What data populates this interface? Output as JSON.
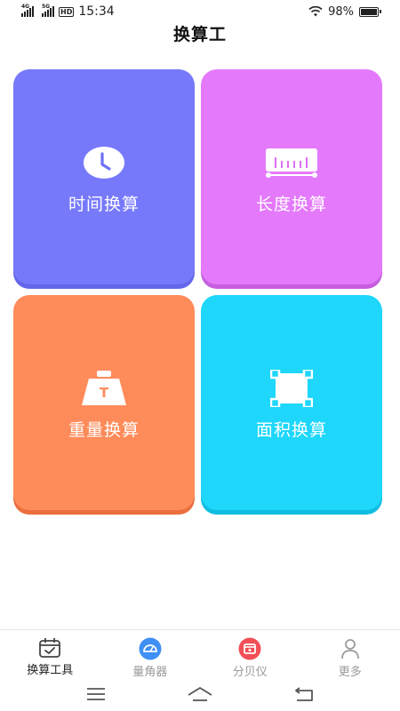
{
  "status_bar": {
    "sim1": "4G",
    "sim2": "5G",
    "hd": "HD",
    "time": "15:34",
    "battery": "98%",
    "battery_level": 0.98
  },
  "header": {
    "title": "换算工"
  },
  "cards": [
    {
      "label": "时间换算",
      "icon": "clock-icon",
      "color": "#7779fb"
    },
    {
      "label": "长度换算",
      "icon": "ruler-icon",
      "color": "#e479fb"
    },
    {
      "label": "重量换算",
      "icon": "weight-icon",
      "color": "#fe8b5a"
    },
    {
      "label": "面积换算",
      "icon": "area-icon",
      "color": "#1ed7fb"
    }
  ],
  "weight_icon_letter": "T",
  "bottom_nav": {
    "items": [
      {
        "label": "换算工具",
        "icon": "calendar-check-icon",
        "active": true
      },
      {
        "label": "量角器",
        "icon": "protractor-icon",
        "active": false
      },
      {
        "label": "分贝仪",
        "icon": "decibel-icon",
        "active": false
      },
      {
        "label": "更多",
        "icon": "user-icon",
        "active": false
      }
    ]
  },
  "system_nav": [
    "menu-icon",
    "home-icon",
    "back-icon"
  ]
}
